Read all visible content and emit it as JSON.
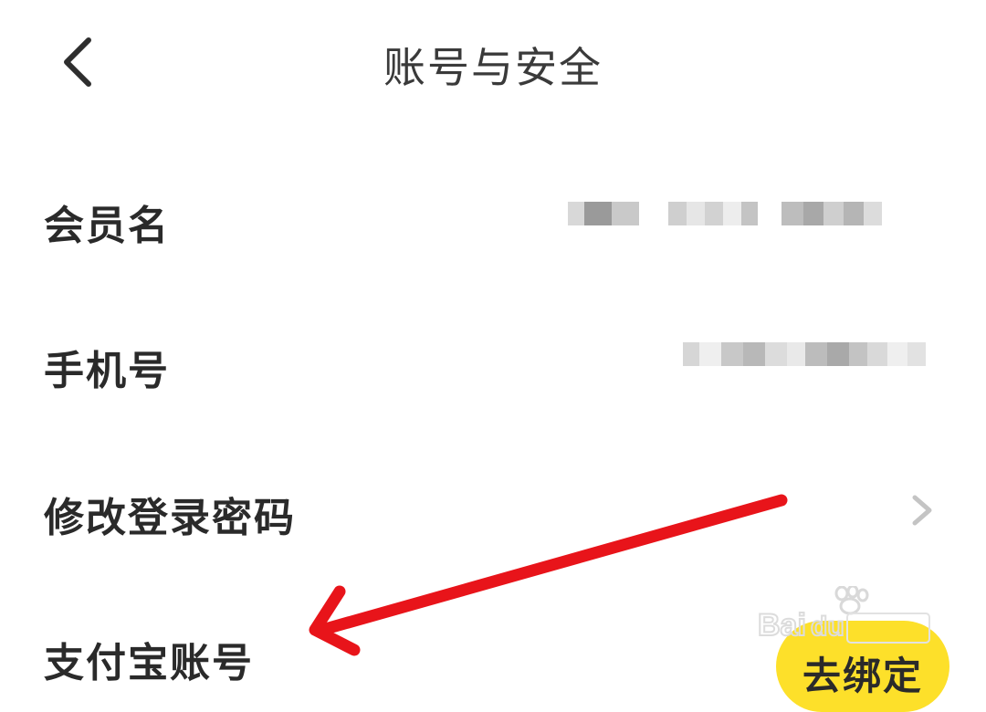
{
  "header": {
    "title": "账号与安全",
    "back_icon": "chevron-left-icon"
  },
  "rows": [
    {
      "label": "会员名",
      "value": "masked"
    },
    {
      "label": "手机号",
      "value": "masked"
    },
    {
      "label": "修改登录密码",
      "trailing_icon": "chevron-right-icon"
    },
    {
      "label": "支付宝账号",
      "action_label": "去绑定"
    }
  ],
  "colors": {
    "action_button": "#fde02a",
    "annotation_arrow": "#e8141a",
    "text": "#2a2a2a"
  },
  "annotation": {
    "type": "arrow",
    "points_to": "支付宝账号"
  }
}
